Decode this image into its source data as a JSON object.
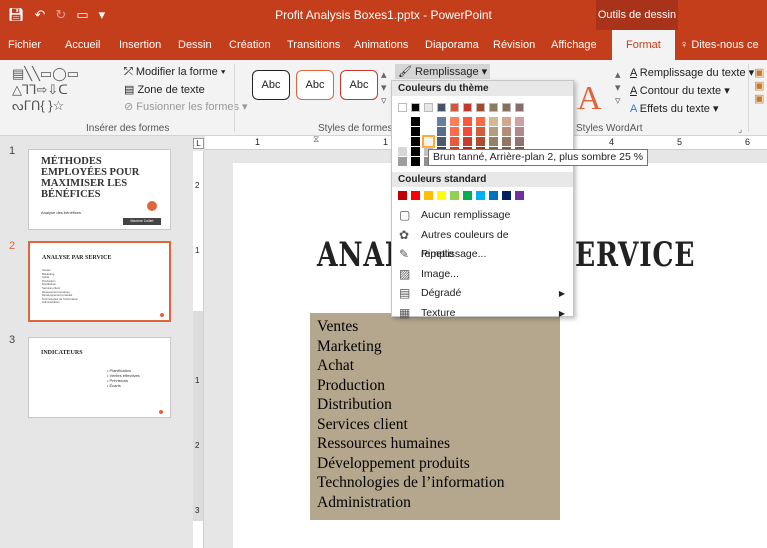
{
  "window": {
    "title": "Profit Analysis Boxes1.pptx - PowerPoint",
    "context_tab_group": "Outils de dessin"
  },
  "tabs": [
    "Fichier",
    "Accueil",
    "Insertion",
    "Dessin",
    "Création",
    "Transitions",
    "Animations",
    "Diaporama",
    "Révision",
    "Affichage",
    "Format",
    "Dites-nous ce q"
  ],
  "active_tab": "Format",
  "ribbon": {
    "insert_shapes": {
      "label": "Insérer des formes",
      "edit_shape": "Modifier la forme",
      "text_box": "Zone de texte",
      "merge_shapes": "Fusionner les formes"
    },
    "shape_styles": {
      "label": "Styles de formes",
      "style_sample": "Abc",
      "fill_button": "Remplissage"
    },
    "wordart": {
      "label": "Styles WordArt",
      "text_fill": "Remplissage du texte",
      "text_outline": "Contour du texte",
      "text_effects": "Effets du texte",
      "letter": "A"
    }
  },
  "slides": [
    {
      "number": "1",
      "title": "MÉTHODES EMPLOYÉES POUR MAXIMISER LES BÉNÉFICES",
      "subtitle": "Analyse des bénéfices",
      "tag": "Maxime Coillet"
    },
    {
      "number": "2",
      "title": "ANALYSE PAR SERVICE",
      "selected": true,
      "items": [
        "Ventes",
        "Marketing",
        "Achat",
        "Production",
        "Distribution",
        "Services client",
        "Ressources humaines",
        "Développement produits",
        "Technologies de l'information",
        "Administration"
      ]
    },
    {
      "number": "3",
      "title": "INDICATEURS",
      "items": [
        "Planification",
        "Ventes effectives",
        "Prévisions",
        "Écarts"
      ]
    }
  ],
  "slide_main": {
    "title_left": "ANAL",
    "title_right": "ERVICE",
    "items": [
      "Ventes",
      "Marketing",
      "Achat",
      "Production",
      "Distribution",
      "Services client",
      "Ressources humaines",
      "Développement produits",
      "Technologies de l’information",
      "Administration"
    ]
  },
  "fill_menu": {
    "theme_colors_header": "Couleurs du thème",
    "standard_colors_header": "Couleurs standard",
    "theme_top_row": [
      "#ffffff",
      "#000000",
      "#e7e6e6",
      "#44546a",
      "#d9543a",
      "#c0392b",
      "#a5482d",
      "#8c7b61",
      "#8c6e5f",
      "#8a6b6b"
    ],
    "standard_colors": [
      "#c00000",
      "#ff0000",
      "#ffc000",
      "#ffff00",
      "#92d050",
      "#00b050",
      "#00b0f0",
      "#0070c0",
      "#002060",
      "#7030a0"
    ],
    "items": [
      {
        "label": "Aucun remplissage",
        "icon": "no-fill-icon",
        "submenu": false
      },
      {
        "label": "Autres couleurs de remplissage...",
        "icon": "color-wheel-icon",
        "submenu": false
      },
      {
        "label": "Pipette",
        "icon": "eyedropper-icon",
        "submenu": false
      },
      {
        "label": "Image...",
        "icon": "picture-icon",
        "submenu": false
      },
      {
        "label": "Dégradé",
        "icon": "gradient-icon",
        "submenu": true
      },
      {
        "label": "Texture",
        "icon": "texture-icon",
        "submenu": true
      }
    ],
    "tooltip": "Brun tanné, Arrière-plan 2, plus sombre 25 %"
  },
  "colors": {
    "accent": "#c43e1c",
    "box_fill": "#b5a78d",
    "selected_slide_border": "#e0653d"
  },
  "rulers": {
    "h_ticks": [
      "1",
      "1",
      "4",
      "5",
      "6"
    ],
    "v_ticks": [
      "2",
      "1",
      "1",
      "2",
      "3"
    ]
  }
}
